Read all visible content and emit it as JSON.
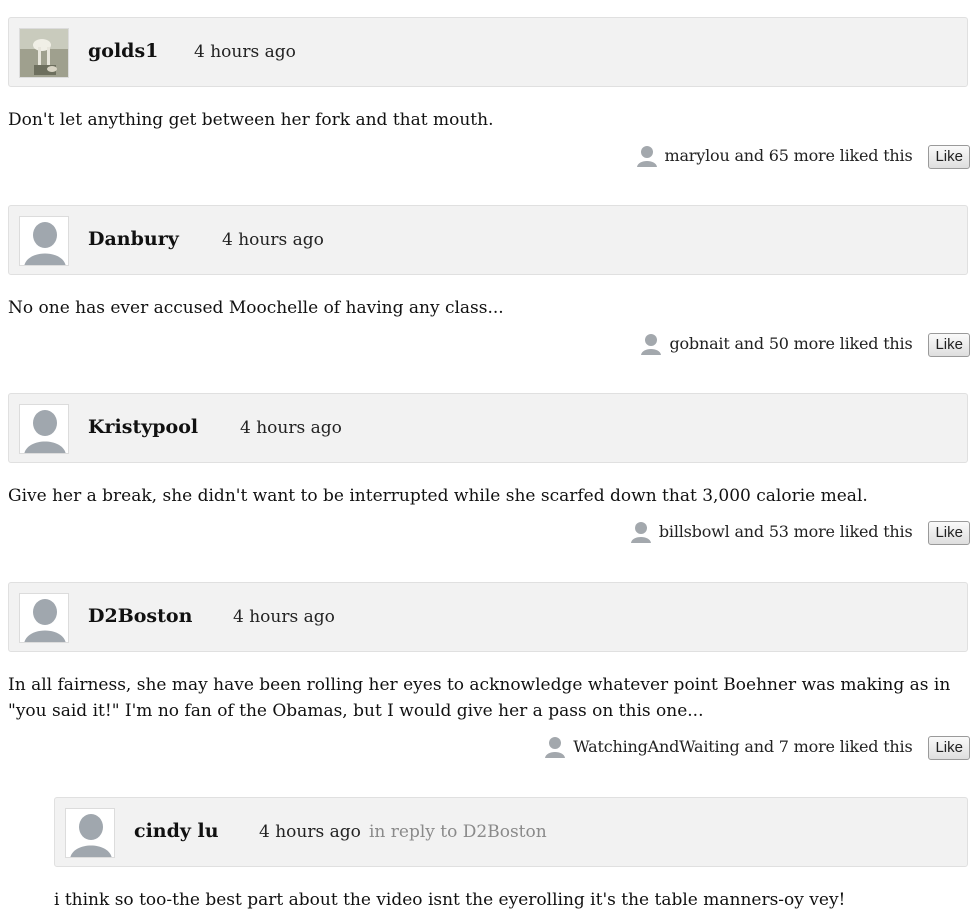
{
  "comments": [
    {
      "username": "golds1",
      "time": "4 hours ago",
      "avatar_icon": "photo-avatar-icon",
      "text": "Don't let anything get between her fork and that mouth.",
      "liked_by": "marylou and 65 more liked this",
      "like_label": "Like"
    },
    {
      "username": "Danbury",
      "time": "4 hours ago",
      "avatar_icon": "default-avatar-icon",
      "text": "No one has ever accused Moochelle of having any class...",
      "liked_by": "gobnait and 50 more liked this",
      "like_label": "Like"
    },
    {
      "username": "Kristypool",
      "time": "4 hours ago",
      "avatar_icon": "default-avatar-icon",
      "text": "Give her a break, she didn't want to be interrupted while she scarfed down that 3,000 calorie meal.",
      "liked_by": "billsbowl and 53 more liked this",
      "like_label": "Like"
    },
    {
      "username": "D2Boston",
      "time": "4 hours ago",
      "avatar_icon": "default-avatar-icon",
      "text": "In all fairness, she may have been rolling her eyes to acknowledge whatever point Boehner was making as in \"you said it!\"  I'm no fan of the Obamas, but I would give her a pass on this one...",
      "liked_by": "WatchingAndWaiting and 7 more liked this",
      "like_label": "Like"
    }
  ],
  "reply": {
    "username": "cindy lu",
    "time": "4 hours ago",
    "in_reply_to": "in reply to D2Boston",
    "avatar_icon": "default-avatar-icon",
    "text": "i think so too-the best part about the video isnt the eyerolling it's the table  manners-oy vey!"
  }
}
